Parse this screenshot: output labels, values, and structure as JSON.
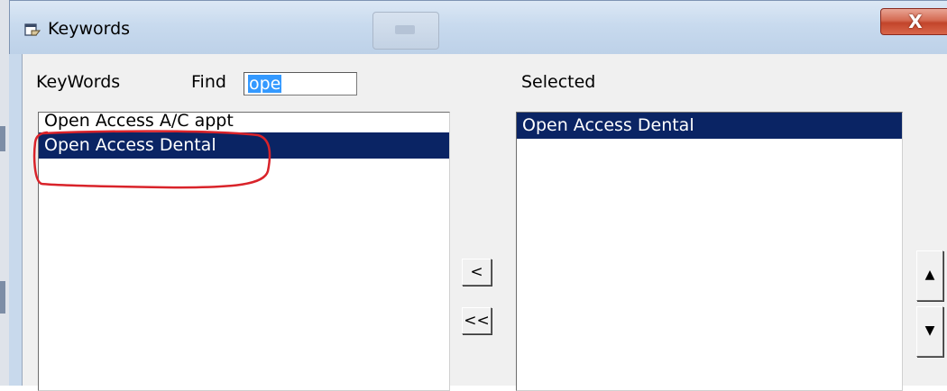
{
  "window": {
    "title": "Keywords",
    "close_glyph": "X",
    "icon": "window-app-icon"
  },
  "left_panel": {
    "label": "KeyWords",
    "find_label": "Find",
    "find_value": "ope",
    "items": [
      {
        "label": "Open Access A/C appt",
        "selected": false
      },
      {
        "label": "Open Access Dental",
        "selected": true
      }
    ]
  },
  "right_panel": {
    "label": "Selected",
    "items": [
      {
        "label": "Open Access Dental",
        "selected": true
      }
    ]
  },
  "buttons": {
    "remove": "<",
    "remove_all": "<<",
    "move_up": "▲",
    "move_down": "▼"
  },
  "colors": {
    "selection": "#0a2464",
    "find_highlight": "#3399ff",
    "annotation": "#d9232a",
    "close_button": "#c2452b"
  }
}
